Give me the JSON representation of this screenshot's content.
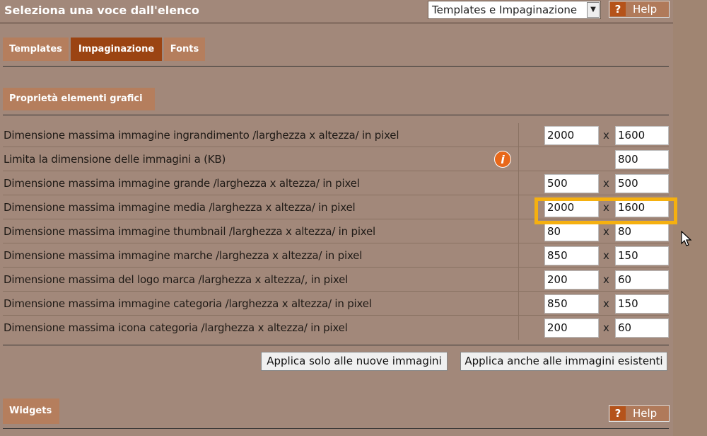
{
  "header": {
    "title": "Seleziona una voce dall'elenco",
    "select_value": "Templates e Impaginazione",
    "help_label": "Help",
    "help_icon": "?"
  },
  "tabs": [
    {
      "label": "Templates",
      "active": false
    },
    {
      "label": "Impaginazione",
      "active": true
    },
    {
      "label": "Fonts",
      "active": false
    }
  ],
  "section": {
    "title": "Proprietà elementi grafici"
  },
  "rows": [
    {
      "label": "Dimensione massima immagine ingrandimento /larghezza x altezza/ in pixel",
      "w": "2000",
      "h": "1600"
    },
    {
      "label": "Limita la dimensione delle immagini a (KB)",
      "h": "800",
      "info_icon": "i"
    },
    {
      "label": "Dimensione massima immagine grande /larghezza x altezza/ in pixel",
      "w": "500",
      "h": "500"
    },
    {
      "label": "Dimensione massima immagine media /larghezza x altezza/ in pixel",
      "w": "2000",
      "h": "1600"
    },
    {
      "label": "Dimensione massima immagine thumbnail /larghezza x altezza/ in pixel",
      "w": "80",
      "h": "80"
    },
    {
      "label": "Dimensione massima immagine marche /larghezza x altezza/ in pixel",
      "w": "850",
      "h": "150"
    },
    {
      "label": "Dimensione massima del logo marca /larghezza x altezza/, in pixel",
      "w": "200",
      "h": "60"
    },
    {
      "label": "Dimensione massima immagine categoria /larghezza x altezza/ in pixel",
      "w": "850",
      "h": "150"
    },
    {
      "label": "Dimensione massima icona categoria /larghezza x altezza/ in pixel",
      "w": "200",
      "h": "60"
    }
  ],
  "x_sign": "x",
  "buttons": {
    "apply_new": "Applica solo alle nuove immagini",
    "apply_all": "Applica anche alle immagini esistenti"
  },
  "widgets": {
    "title": "Widgets",
    "help_label": "Help",
    "help_icon": "?"
  },
  "colors": {
    "background": "#a2887a",
    "tab_active": "#9b4412",
    "tab_inactive": "#b57e5d",
    "highlight": "#f5b010"
  }
}
